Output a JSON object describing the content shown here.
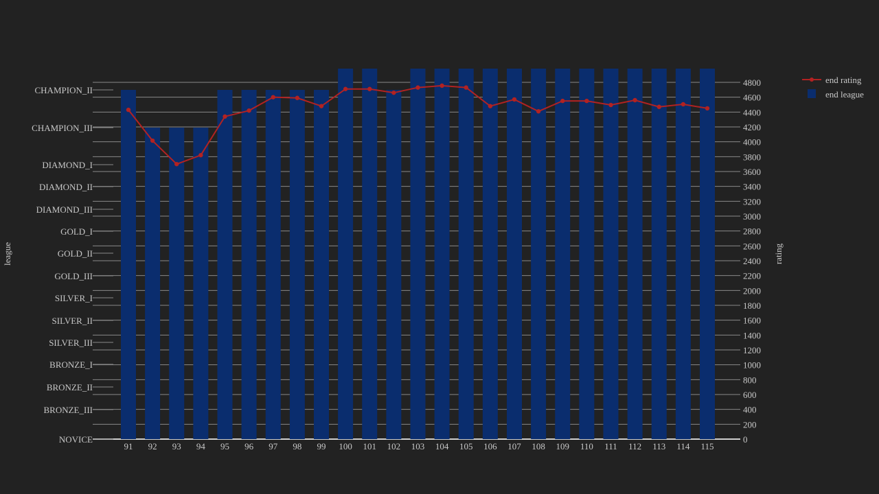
{
  "chart_data": {
    "type": "bar",
    "x": [
      91,
      92,
      93,
      94,
      95,
      96,
      97,
      98,
      99,
      100,
      101,
      102,
      103,
      104,
      105,
      106,
      107,
      108,
      109,
      110,
      111,
      112,
      113,
      114,
      115
    ],
    "y_left_label": "league",
    "y_right_label": "rating",
    "league_categories": [
      "NOVICE",
      "BRONZE_III",
      "BRONZE_II",
      "BRONZE_I",
      "SILVER_III",
      "SILVER_II",
      "SILVER_I",
      "GOLD_III",
      "GOLD_II",
      "GOLD_I",
      "DIAMOND_III",
      "DIAMOND_II",
      "DIAMOND_I",
      "CHAMPION_III",
      "CHAMPION_II"
    ],
    "right_ticks": [
      0,
      200,
      400,
      600,
      800,
      1000,
      1200,
      1400,
      1600,
      1800,
      2000,
      2200,
      2400,
      2600,
      2800,
      3000,
      3200,
      3400,
      3600,
      3800,
      4000,
      4200,
      4400,
      4600,
      4800
    ],
    "right_range": [
      0,
      4800
    ],
    "grid": true,
    "legend_position": "top-right",
    "series": [
      {
        "name": "end rating",
        "type": "line",
        "axis": "right",
        "color": "#b22222",
        "values": [
          4430,
          4015,
          3700,
          3820,
          4340,
          4420,
          4600,
          4590,
          4480,
          4710,
          4710,
          4660,
          4730,
          4755,
          4730,
          4480,
          4570,
          4410,
          4550,
          4550,
          4495,
          4560,
          4470,
          4505,
          4450
        ]
      },
      {
        "name": "end league",
        "type": "bar",
        "axis": "left",
        "color": "#0a2d6e",
        "values": [
          "CHAMPION_II",
          "CHAMPION_III",
          "CHAMPION_III",
          "CHAMPION_III",
          "CHAMPION_II",
          "CHAMPION_II",
          "CHAMPION_II",
          "CHAMPION_II",
          "CHAMPION_II",
          "CHAMPION_I",
          "CHAMPION_I",
          "CHAMPION_II",
          "CHAMPION_I",
          "CHAMPION_I",
          "CHAMPION_I",
          "CHAMPION_I",
          "CHAMPION_I",
          "CHAMPION_I",
          "CHAMPION_I",
          "CHAMPION_I",
          "CHAMPION_I",
          "CHAMPION_I",
          "CHAMPION_I",
          "CHAMPION_I",
          "CHAMPION_I"
        ]
      }
    ]
  }
}
